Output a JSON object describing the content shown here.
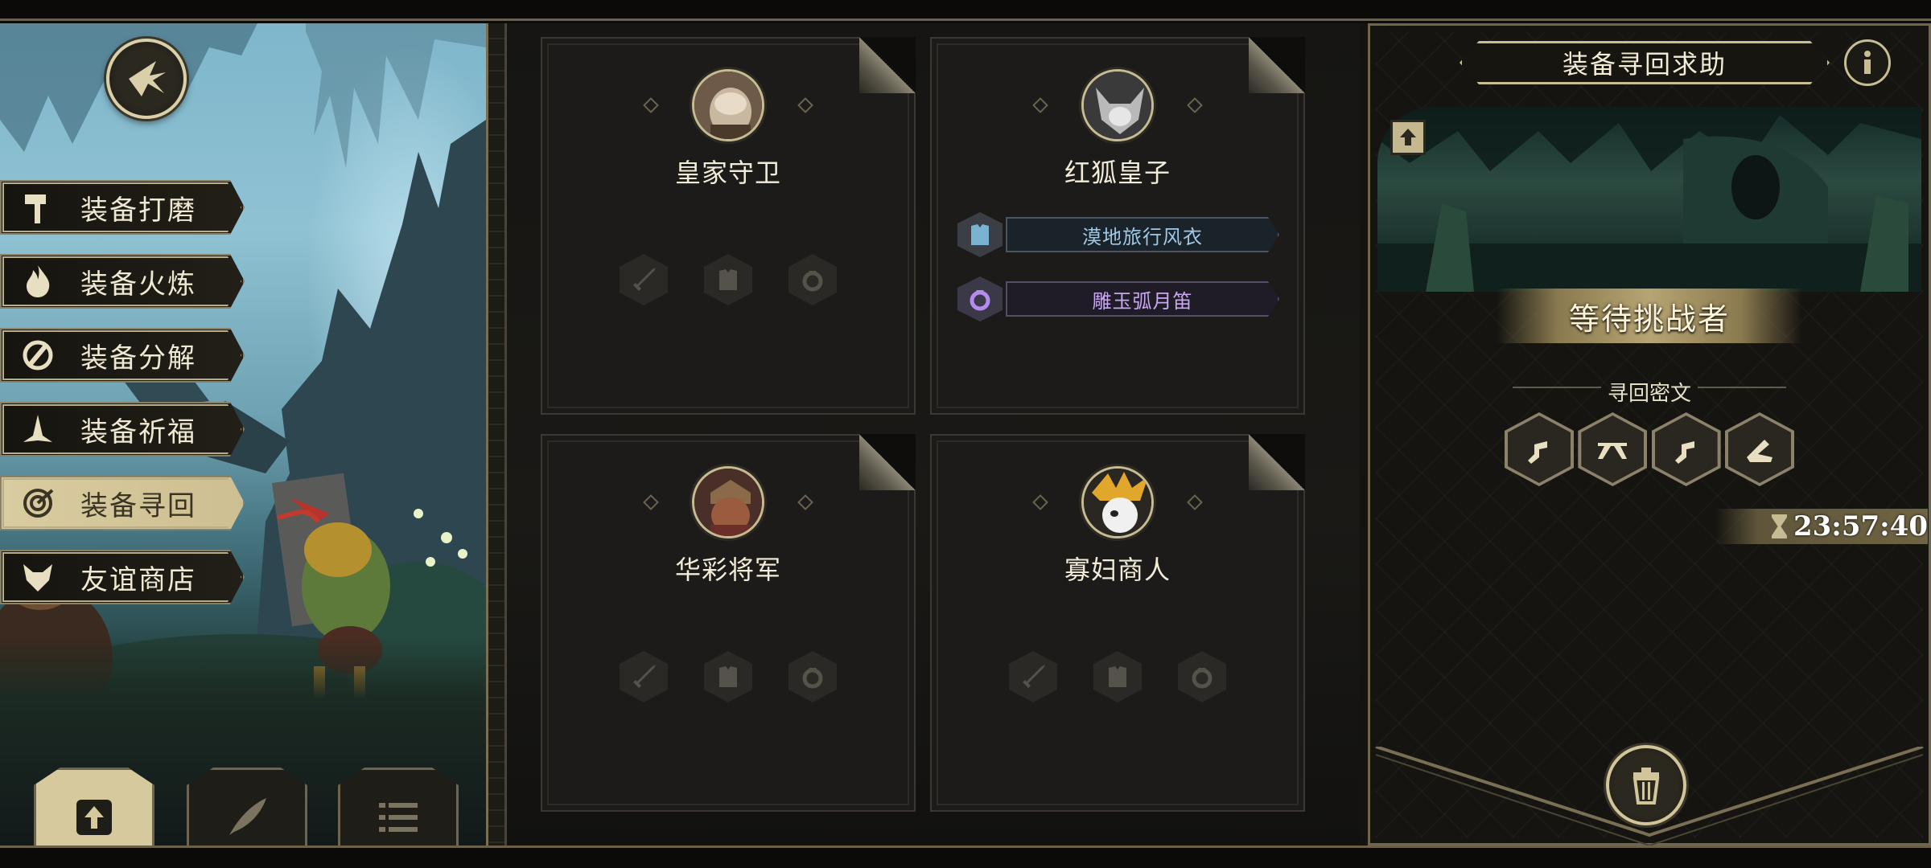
{
  "side_menu": {
    "items": [
      {
        "label": "装备打磨",
        "icon": "hammer-icon",
        "active": false
      },
      {
        "label": "装备火炼",
        "icon": "flame-icon",
        "active": false
      },
      {
        "label": "装备分解",
        "icon": "disassemble-icon",
        "active": false
      },
      {
        "label": "装备祈福",
        "icon": "pray-hands-icon",
        "active": false
      },
      {
        "label": "装备寻回",
        "icon": "target-icon",
        "active": true
      },
      {
        "label": "友谊商店",
        "icon": "fox-head-icon",
        "active": false
      }
    ]
  },
  "bottom_tabs": [
    {
      "icon": "upload-icon",
      "active": true
    },
    {
      "icon": "feather-icon",
      "active": false
    },
    {
      "icon": "list-icon",
      "active": false
    }
  ],
  "cards": [
    {
      "name": "皇家守卫",
      "portrait": "royal-guard-portrait",
      "equipment": []
    },
    {
      "name": "红狐皇子",
      "portrait": "red-fox-prince-portrait",
      "equipment": [
        {
          "name": "漠地旅行风衣",
          "icon": "armor-icon",
          "color": "#9fc8e6"
        },
        {
          "name": "雕玉弧月笛",
          "icon": "ring-icon",
          "color": "#c9a8f0"
        }
      ]
    },
    {
      "name": "华彩将军",
      "portrait": "colorful-general-portrait",
      "equipment": []
    },
    {
      "name": "寡妇商人",
      "portrait": "widow-merchant-portrait",
      "equipment": []
    }
  ],
  "empty_slot_icons": [
    "sword-icon",
    "armor-icon",
    "ring-icon"
  ],
  "panel": {
    "title": "装备寻回求助",
    "status": "等待挑战者",
    "cipher_label": "寻回密文",
    "runes": [
      "rune-1-icon",
      "rune-2-icon",
      "rune-3-icon",
      "rune-4-icon"
    ],
    "timer": "23:57:40"
  },
  "colors": {
    "gold_border": "#c9bd92",
    "active_menu": "#d9cca0",
    "blue_item": "#9fc8e6",
    "purple_item": "#c9a8f0"
  }
}
